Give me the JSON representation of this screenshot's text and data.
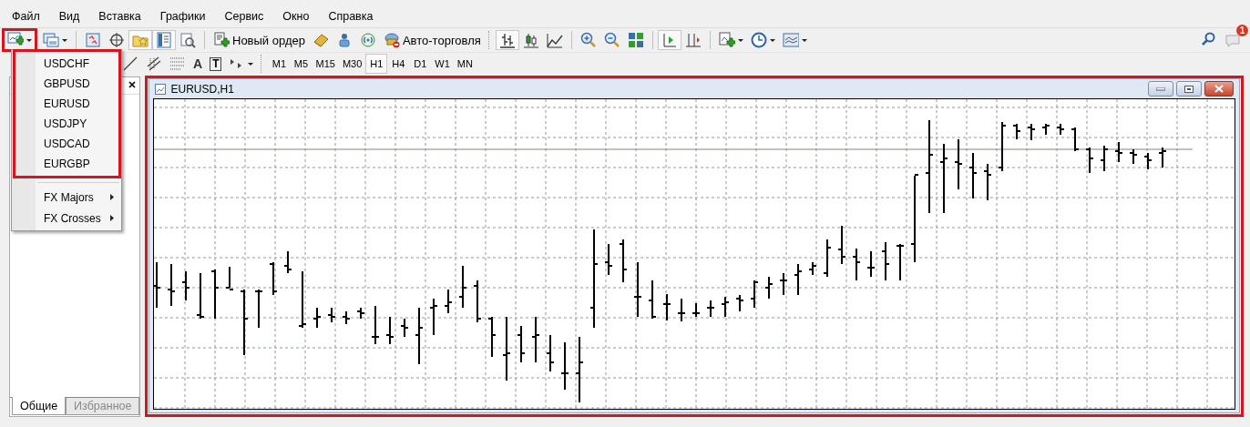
{
  "menu_bar": [
    {
      "label": "Файл"
    },
    {
      "label": "Вид"
    },
    {
      "label": "Вставка"
    },
    {
      "label": "Графики"
    },
    {
      "label": "Сервис"
    },
    {
      "label": "Окно"
    },
    {
      "label": "Справка"
    }
  ],
  "toolbar": {
    "new_order": "Новый ордер",
    "autotrading": "Авто-торговля",
    "notification_count": "1"
  },
  "drawing_toolbar": {
    "text_tool": "A",
    "label_tool": "T"
  },
  "timeframes": [
    {
      "label": "M1",
      "selected": false
    },
    {
      "label": "M5",
      "selected": false
    },
    {
      "label": "M15",
      "selected": false
    },
    {
      "label": "M30",
      "selected": false
    },
    {
      "label": "H1",
      "selected": true
    },
    {
      "label": "H4",
      "selected": false
    },
    {
      "label": "D1",
      "selected": false
    },
    {
      "label": "W1",
      "selected": false
    },
    {
      "label": "MN",
      "selected": false
    }
  ],
  "symbol_menu": {
    "symbols": [
      "USDCHF",
      "GBPUSD",
      "EURUSD",
      "USDJPY",
      "USDCAD",
      "EURGBP"
    ],
    "groups": [
      {
        "label": "FX Majors"
      },
      {
        "label": "FX Crosses"
      }
    ]
  },
  "navigator": {
    "tabs": [
      {
        "label": "Общие",
        "selected": true
      },
      {
        "label": "Избранное",
        "selected": false
      }
    ]
  },
  "chart_window": {
    "title": "EURUSD,H1"
  }
}
